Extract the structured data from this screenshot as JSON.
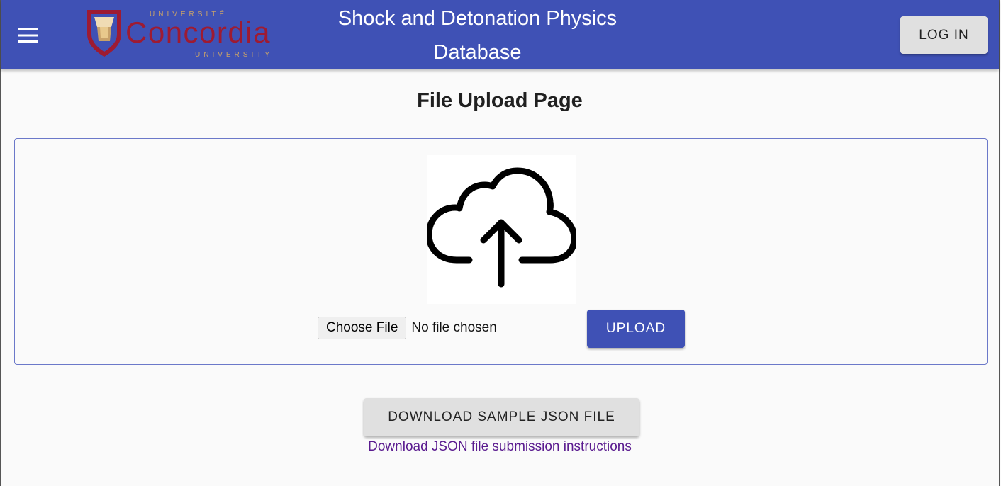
{
  "header": {
    "title": "Shock and Detonation Physics Database",
    "login_label": "LOG IN",
    "logo": {
      "top_text": "UNIVERSITÉ",
      "main_text": "Concordia",
      "bottom_text": "UNIVERSITY"
    },
    "menu_icon": "hamburger-menu-icon"
  },
  "main": {
    "page_title": "File Upload Page",
    "upload_icon": "cloud-upload-icon",
    "choose_file_label": "Choose File",
    "file_status": "No file chosen",
    "upload_label": "UPLOAD",
    "download_sample_label": "DOWNLOAD SAMPLE JSON FILE",
    "instructions_link": "Download JSON file submission instructions"
  },
  "colors": {
    "appbar": "#3f51b5",
    "primary_button": "#3f51b5",
    "secondary_button": "#e0e0e0",
    "link": "#5a1b8f",
    "logo_red": "#9e1b32",
    "logo_gold": "#c8a26a"
  }
}
